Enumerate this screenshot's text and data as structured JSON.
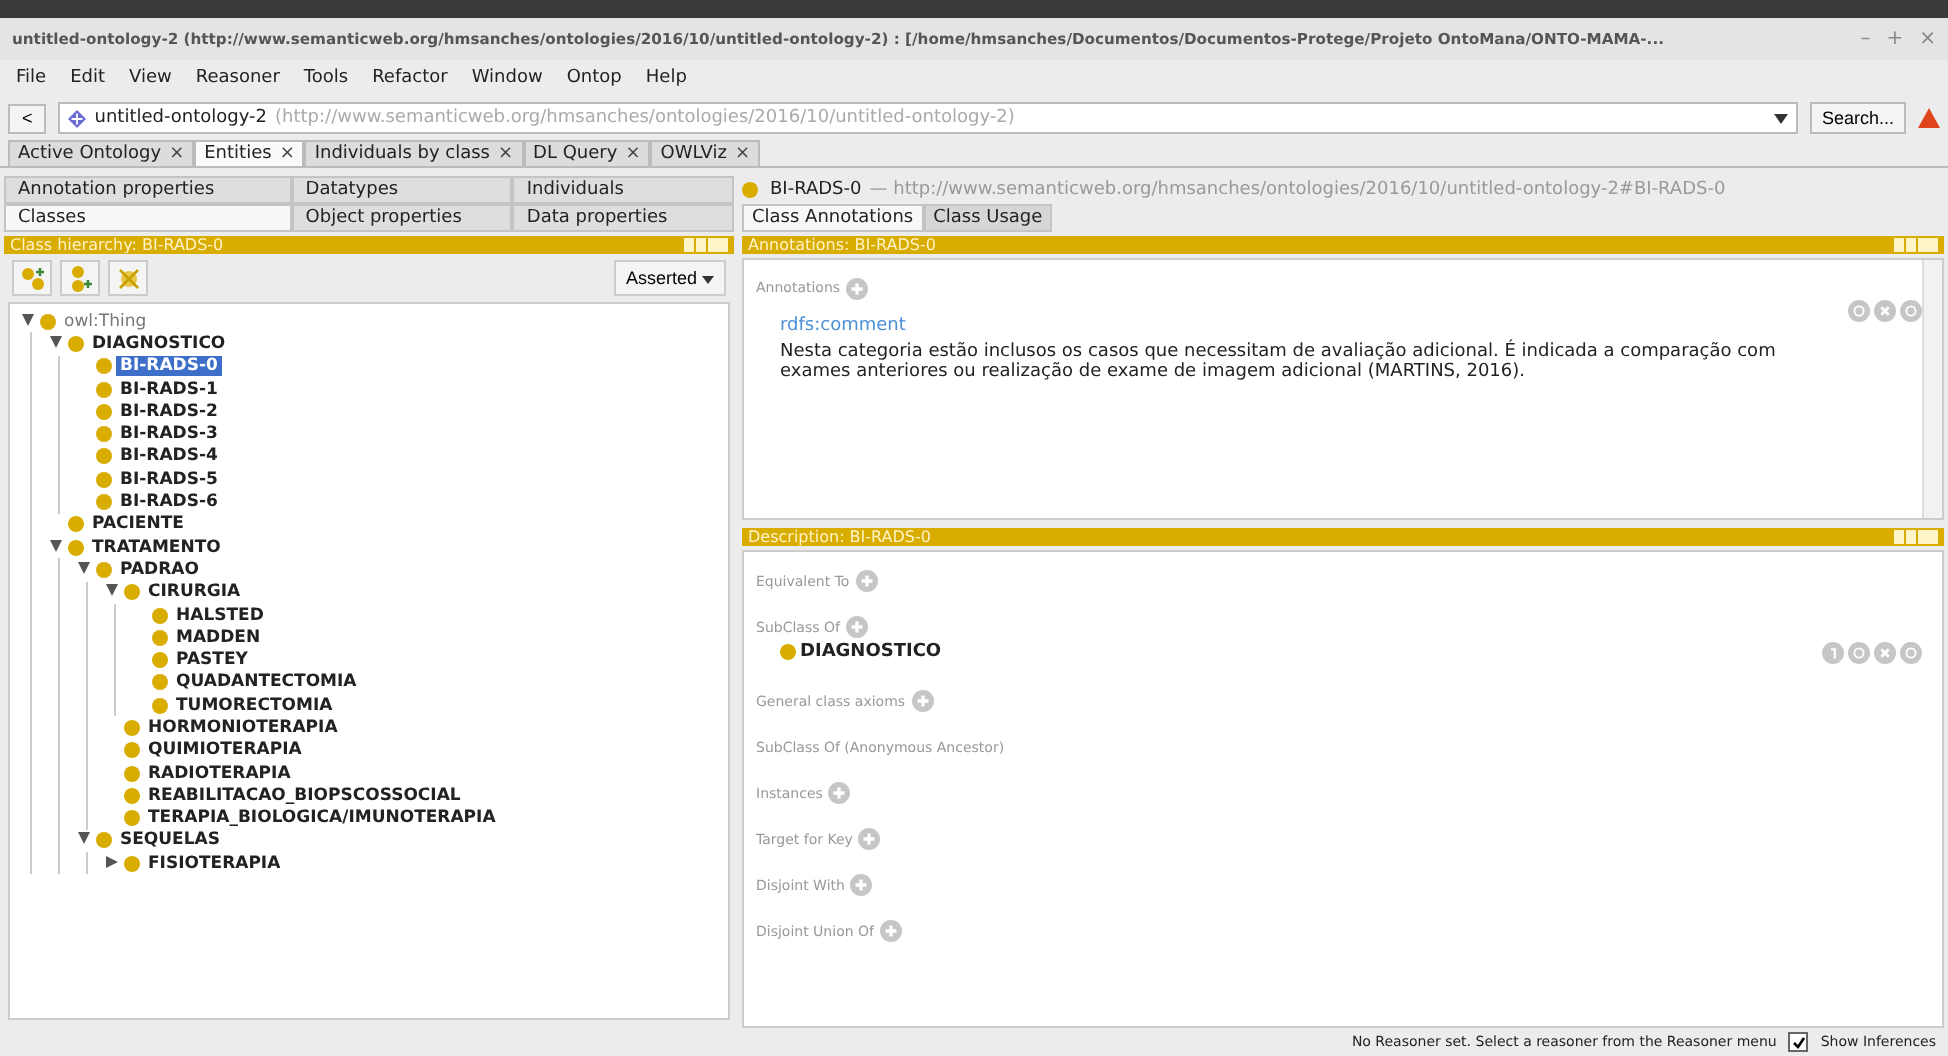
{
  "window": {
    "title": "untitled-ontology-2 (http://www.semanticweb.org/hmsanches/ontologies/2016/10/untitled-ontology-2) : [/home/hmsanches/Documentos/Documentos-Protege/Projeto OntoMana/ONTO-MAMA-...",
    "controls": [
      "–",
      "+",
      "×"
    ]
  },
  "menu": [
    "File",
    "Edit",
    "View",
    "Reasoner",
    "Tools",
    "Refactor",
    "Window",
    "Ontop",
    "Help"
  ],
  "nav": {
    "back": "<",
    "ontology": "untitled-ontology-2",
    "iri": "(http://www.semanticweb.org/hmsanches/ontologies/2016/10/untitled-ontology-2)",
    "search": "Search..."
  },
  "workspace_tabs": [
    {
      "label": "Active Ontology",
      "close": "×",
      "selected": false
    },
    {
      "label": "Entities",
      "close": "×",
      "selected": true
    },
    {
      "label": "Individuals by class",
      "close": "×",
      "selected": false
    },
    {
      "label": "DL Query",
      "close": "×",
      "selected": false
    },
    {
      "label": "OWLViz",
      "close": "×",
      "selected": false
    }
  ],
  "entity_tabs": [
    [
      {
        "label": "Annotation properties",
        "selected": false
      },
      {
        "label": "Datatypes",
        "selected": false
      },
      {
        "label": "Individuals",
        "selected": false
      }
    ],
    [
      {
        "label": "Classes",
        "selected": true
      },
      {
        "label": "Object properties",
        "selected": false
      },
      {
        "label": "Data properties",
        "selected": false
      }
    ]
  ],
  "hierarchy": {
    "title": "Class hierarchy: BI-RADS-0",
    "mode": "Asserted",
    "tree": [
      {
        "label": "owl:Thing",
        "expanded": true,
        "selected": false,
        "children": [
          {
            "label": "DIAGNOSTICO",
            "expanded": true,
            "selected": false,
            "children": [
              {
                "label": "BI-RADS-0",
                "selected": true
              },
              {
                "label": "BI-RADS-1",
                "selected": false
              },
              {
                "label": "BI-RADS-2",
                "selected": false
              },
              {
                "label": "BI-RADS-3",
                "selected": false
              },
              {
                "label": "BI-RADS-4",
                "selected": false
              },
              {
                "label": "BI-RADS-5",
                "selected": false
              },
              {
                "label": "BI-RADS-6",
                "selected": false
              }
            ]
          },
          {
            "label": "PACIENTE",
            "selected": false
          },
          {
            "label": "TRATAMENTO",
            "expanded": true,
            "selected": false,
            "children": [
              {
                "label": "PADRAO",
                "expanded": true,
                "selected": false,
                "children": [
                  {
                    "label": "CIRURGIA",
                    "expanded": true,
                    "selected": false,
                    "children": [
                      {
                        "label": "HALSTED",
                        "selected": false
                      },
                      {
                        "label": "MADDEN",
                        "selected": false
                      },
                      {
                        "label": "PASTEY",
                        "selected": false
                      },
                      {
                        "label": "QUADANTECTOMIA",
                        "selected": false
                      },
                      {
                        "label": "TUMORECTOMIA",
                        "selected": false
                      }
                    ]
                  },
                  {
                    "label": "HORMONIOTERAPIA",
                    "selected": false
                  },
                  {
                    "label": "QUIMIOTERAPIA",
                    "selected": false
                  },
                  {
                    "label": "RADIOTERAPIA",
                    "selected": false
                  },
                  {
                    "label": "REABILITACAO_BIOPSCOSSOCIAL",
                    "selected": false
                  },
                  {
                    "label": "TERAPIA_BIOLOGICA/IMUNOTERAPIA",
                    "selected": false
                  }
                ]
              },
              {
                "label": "SEQUELAS",
                "expanded": true,
                "selected": false,
                "children": [
                  {
                    "label": "FISIOTERAPIA",
                    "expanded": false,
                    "selected": false
                  }
                ]
              }
            ]
          }
        ]
      }
    ]
  },
  "entity": {
    "name": "BI-RADS-0",
    "iri": "— http://www.semanticweb.org/hmsanches/ontologies/2016/10/untitled-ontology-2#BI-RADS-0"
  },
  "detail_tabs": [
    {
      "label": "Class Annotations",
      "selected": true
    },
    {
      "label": "Class Usage",
      "selected": false
    }
  ],
  "annotations": {
    "title": "Annotations: BI-RADS-0",
    "label": "Annotations",
    "property": "rdfs:comment",
    "text": "Nesta categoria estão inclusos os casos que necessitam de avaliação adicional. É indicada a comparação com exames anteriores ou realização de exame de imagem adicional (MARTINS, 2016)."
  },
  "description": {
    "title": "Description: BI-RADS-0",
    "sections": [
      {
        "label": "Equivalent To",
        "addable": true
      },
      {
        "label": "SubClass Of",
        "addable": true,
        "items": [
          "DIAGNOSTICO"
        ]
      },
      {
        "label": "General class axioms",
        "addable": true
      },
      {
        "label": "SubClass Of (Anonymous Ancestor)",
        "addable": false
      },
      {
        "label": "Instances",
        "addable": true
      },
      {
        "label": "Target for Key",
        "addable": true
      },
      {
        "label": "Disjoint With",
        "addable": true
      },
      {
        "label": "Disjoint Union Of",
        "addable": true
      }
    ]
  },
  "status": {
    "text": "No Reasoner set. Select a reasoner from the Reasoner menu",
    "show_inferences": {
      "label": "Show Inferences",
      "checked": true
    }
  }
}
